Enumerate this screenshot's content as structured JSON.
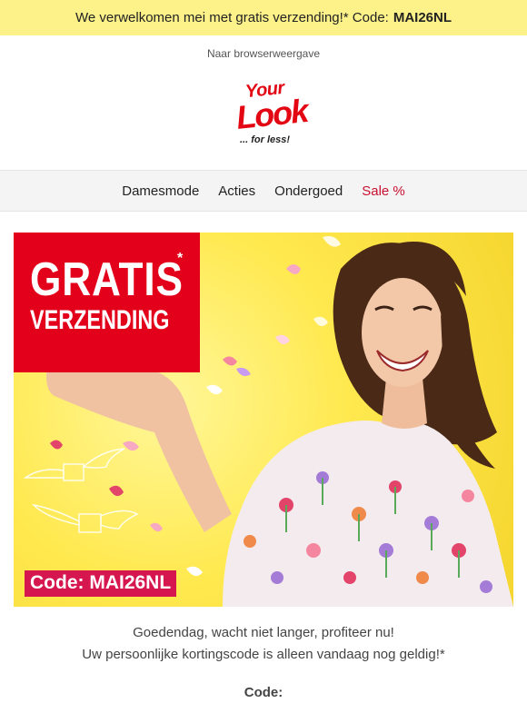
{
  "topbar": {
    "text": "We verwelkomen mei met gratis verzending!* Code:",
    "code": "MAI26NL"
  },
  "browser_link": "Naar browserweergave",
  "logo": {
    "line1": "Your",
    "line2": "Look",
    "line3": "... for less!"
  },
  "nav": {
    "items": [
      "Damesmode",
      "Acties",
      "Ondergoed",
      "Sale %"
    ]
  },
  "hero": {
    "badge_line1": "GRATIS",
    "badge_star": "*",
    "badge_line2": "VERZENDING",
    "code": "Code: MAI26NL"
  },
  "greeting": {
    "line1": "Goedendag, wacht niet langer, profiteer nu!",
    "line2": "Uw persoonlijke kortingscode is alleen vandaag nog geldig!*"
  },
  "code_label": "Code:",
  "colors": {
    "topbar_bg": "#fdf28a",
    "brand_red": "#e30613",
    "sale_red": "#c8102e",
    "hero_yellow": "#ffe84a",
    "code_pink": "#d5164f"
  }
}
